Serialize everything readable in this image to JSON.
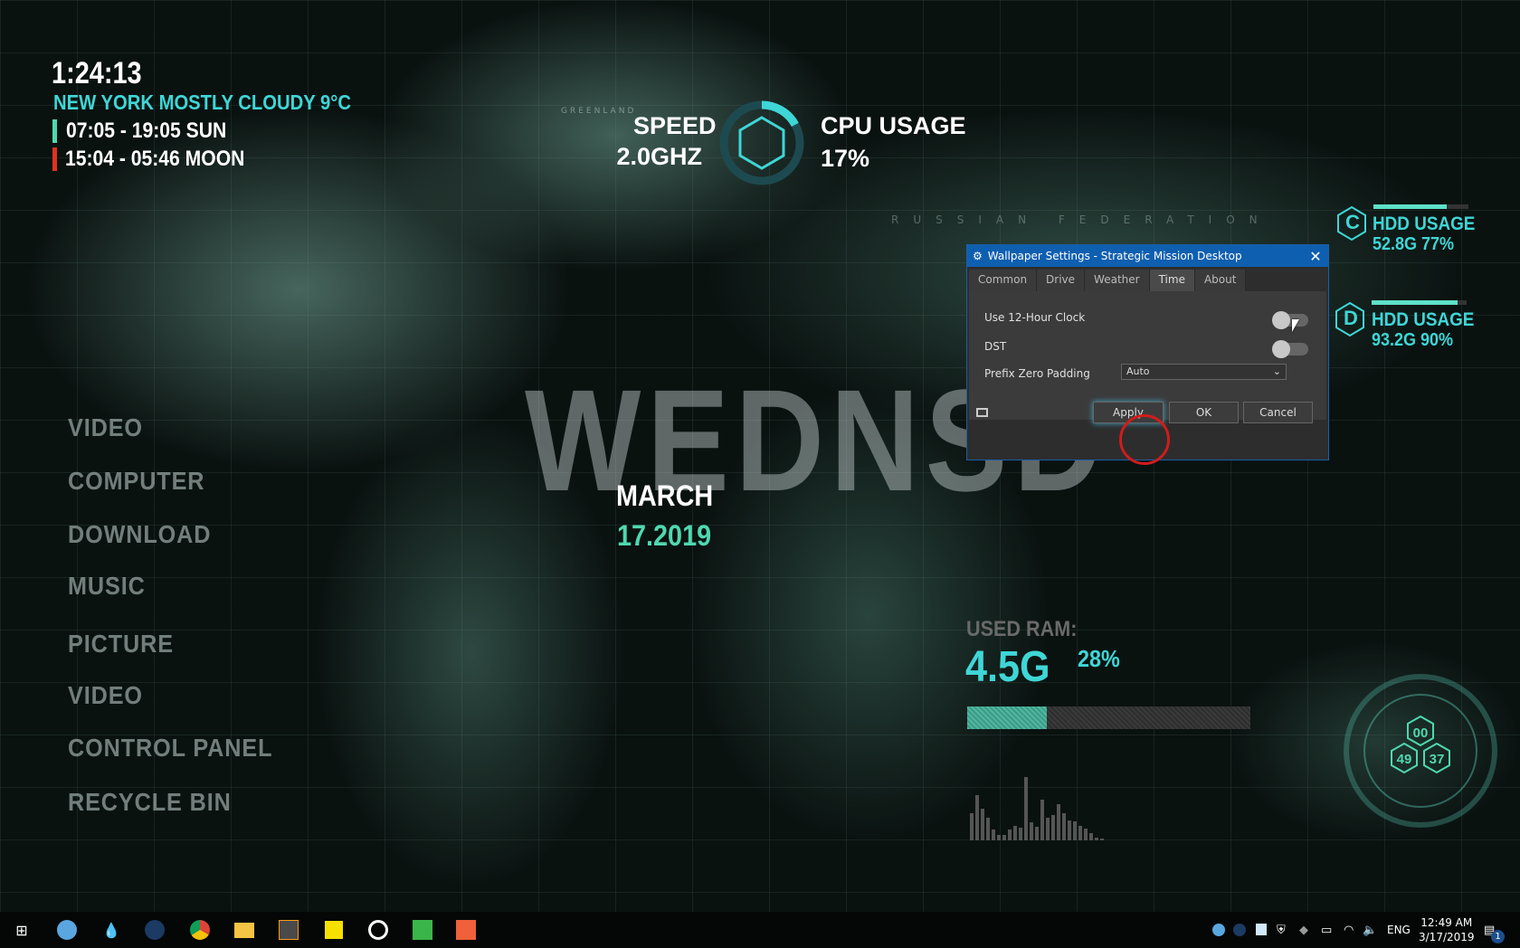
{
  "widgets": {
    "clock": "1:24:13",
    "weather": "NEW YORK MOSTLY CLOUDY 9°C",
    "sun": "07:05 - 19:05 SUN",
    "moon": "15:04 - 05:46 MOON",
    "speed_label": "SPEED",
    "speed_value": "2.0GHZ",
    "cpu_label": "CPU USAGE",
    "cpu_value": "17%",
    "cpu_fraction": 0.17,
    "hdd_c": {
      "letter": "C",
      "label": "HDD USAGE",
      "value": "52.8G 77%",
      "fraction": 0.77
    },
    "hdd_d": {
      "letter": "D",
      "label": "HDD USAGE",
      "value": "93.2G 90%",
      "fraction": 0.9
    },
    "day": "WEDNSD",
    "month": "MARCH",
    "date": "17.2019",
    "ram_label": "USED RAM:",
    "ram_value": "4.5G",
    "ram_percent": "28%",
    "ram_fraction": 0.28,
    "hex": [
      "00",
      "49",
      "37"
    ],
    "map_labels": {
      "greenland": "GREENLAND",
      "russia": "RUSSIAN FEDERATION"
    }
  },
  "menu": [
    "VIDEO",
    "COMPUTER",
    "DOWNLOAD",
    "MUSIC",
    "PICTURE",
    "VIDEO",
    "CONTROL PANEL",
    "RECYCLE BIN"
  ],
  "dialog": {
    "title": "Wallpaper Settings - Strategic Mission Desktop",
    "tabs": [
      "Common",
      "Drive",
      "Weather",
      "Time",
      "About"
    ],
    "active_tab": "Time",
    "use12": {
      "label": "Use 12-Hour Clock",
      "on": false
    },
    "dst": {
      "label": "DST",
      "on": false
    },
    "padding": {
      "label": "Prefix Zero Padding",
      "value": "Auto"
    },
    "apply": "Apply",
    "ok": "OK",
    "cancel": "Cancel"
  },
  "taskbar": {
    "icons": [
      "windows-start-icon",
      "droplet-app-icon",
      "water-drop-icon",
      "steam-icon",
      "chrome-icon",
      "file-explorer-icon",
      "sublime-text-icon",
      "sticky-notes-icon",
      "obs-icon",
      "camtasia-green-icon",
      "camtasia-orange-icon"
    ],
    "lang": "ENG",
    "time": "12:49 AM",
    "date": "3/17/2019",
    "notifications": "1"
  }
}
